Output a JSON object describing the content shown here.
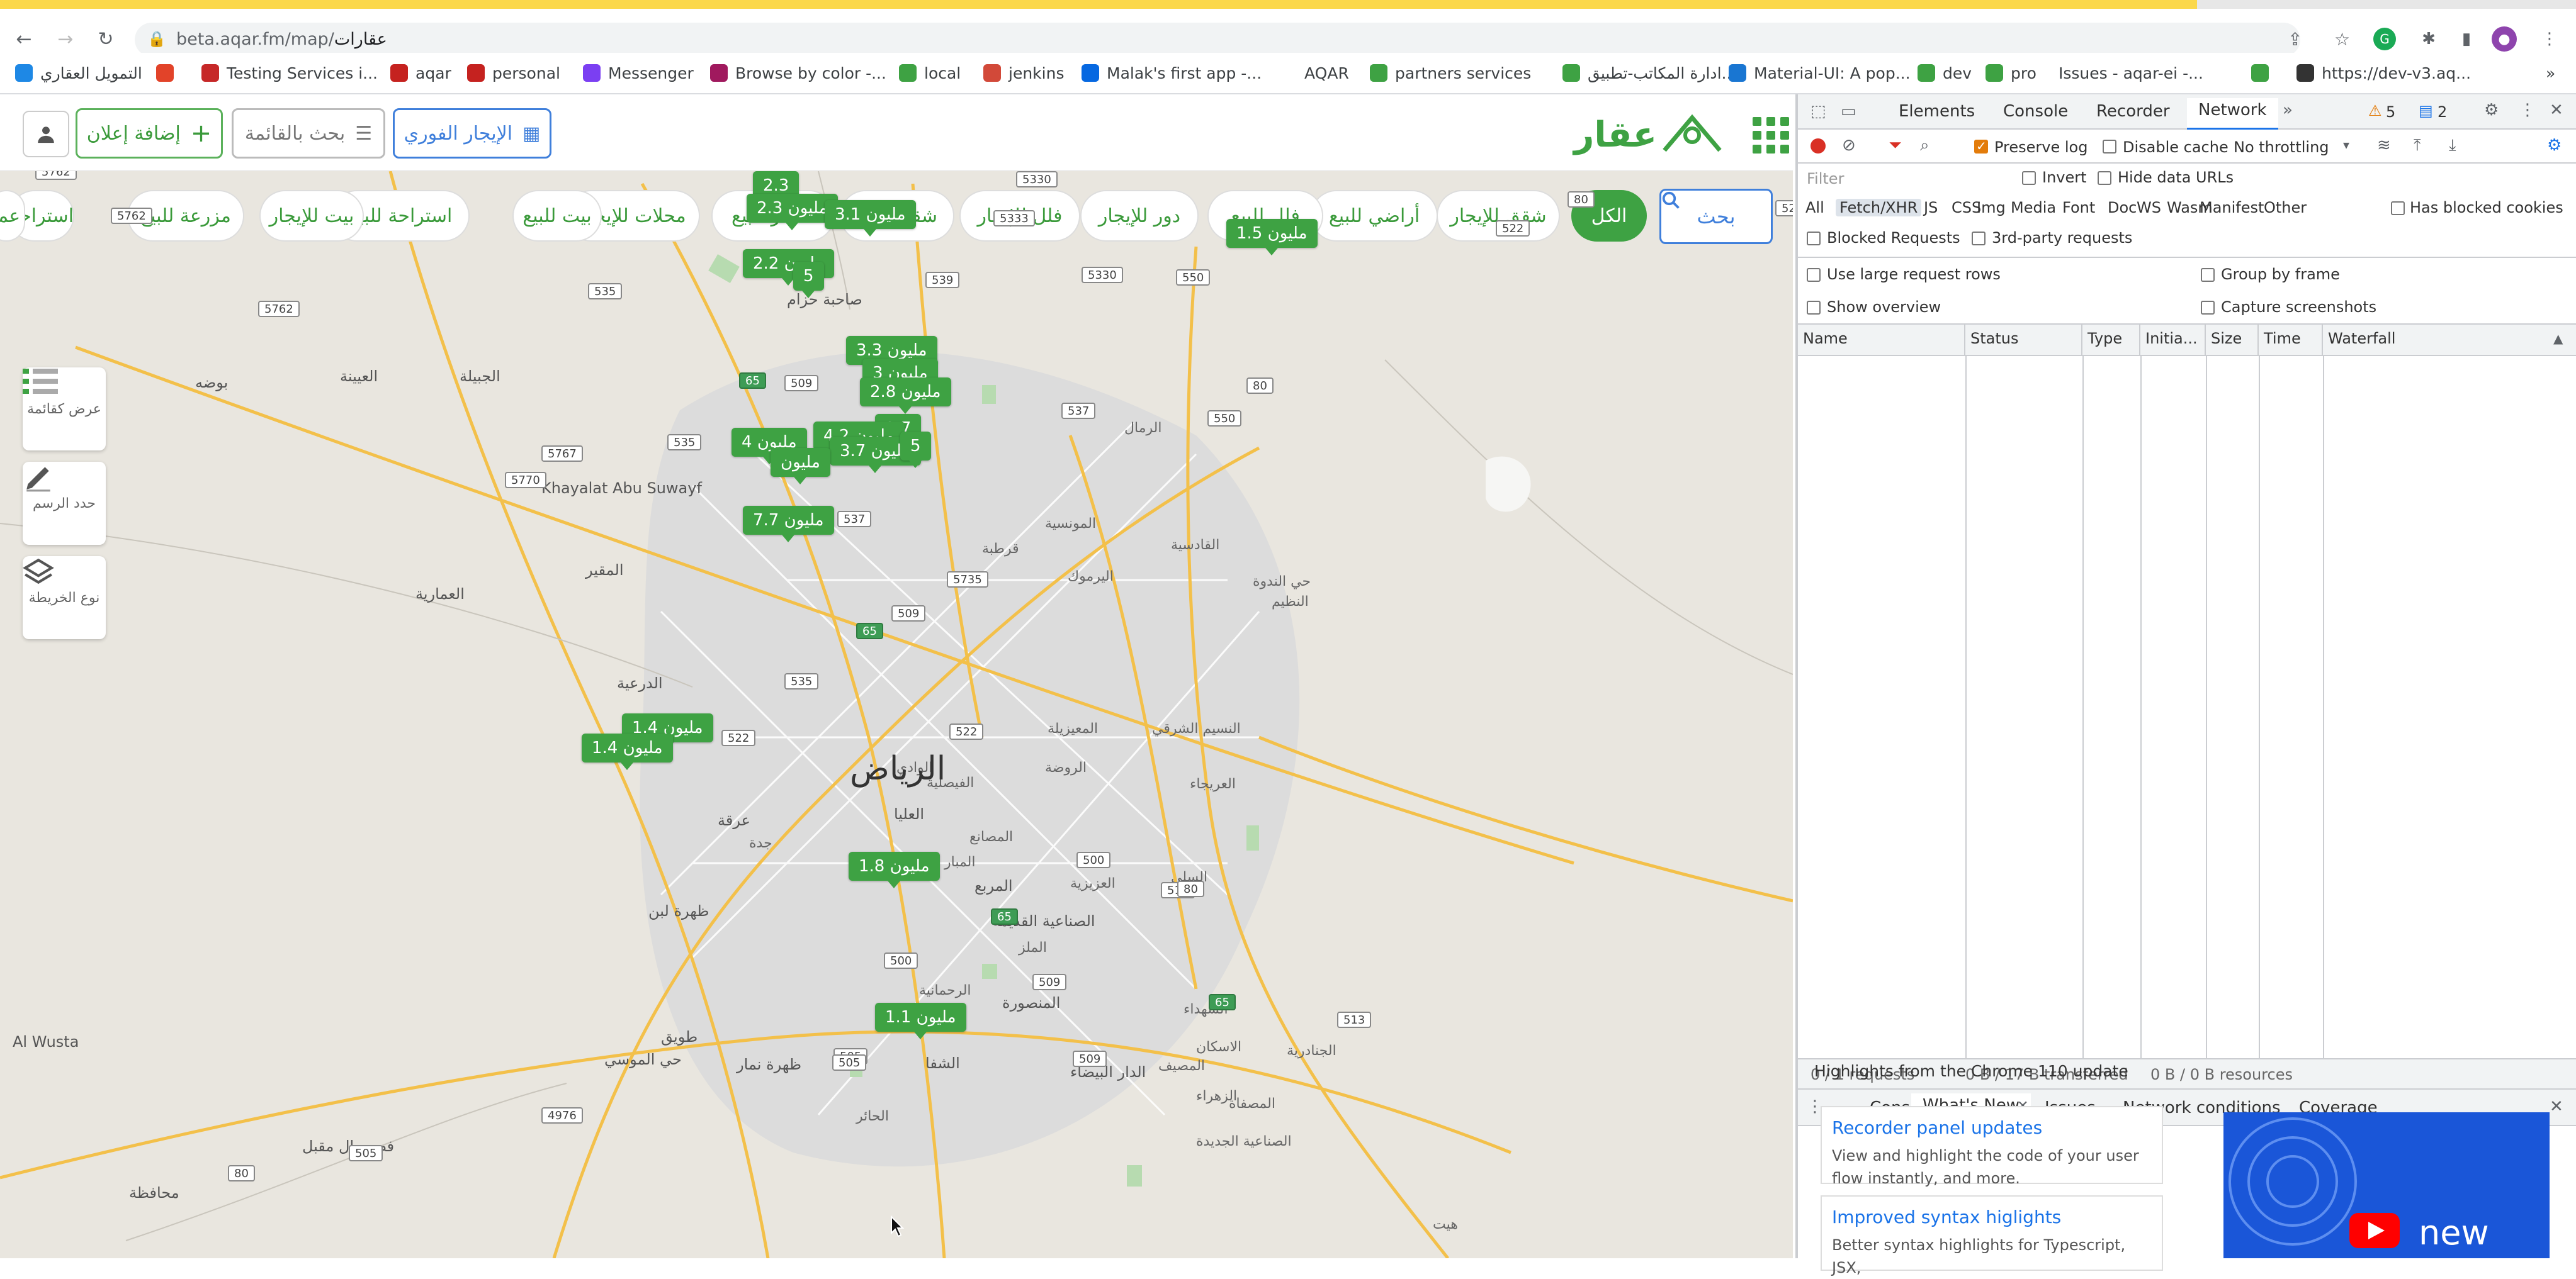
{
  "browser": {
    "url_host": "beta.aqar.fm/map/",
    "url_path": "عقارات",
    "bookmarks": [
      {
        "label": "التمويل العقاري",
        "icon": "globe-icon",
        "color": "#1e88e5"
      },
      {
        "label": "",
        "icon": "gitlab-icon",
        "color": "#e24329"
      },
      {
        "label": "Testing Services i...",
        "icon": "service-icon",
        "color": "#c62828"
      },
      {
        "label": "aqar",
        "icon": "gmail-icon",
        "color": "#c5221f"
      },
      {
        "label": "personal",
        "icon": "gmail-icon",
        "color": "#c5221f"
      },
      {
        "label": "Messenger",
        "icon": "messenger-icon",
        "color": "#7b3ff2"
      },
      {
        "label": "Browse by color -...",
        "icon": "color-icon",
        "color": "#a0195e"
      },
      {
        "label": "local",
        "icon": "leaf-icon",
        "color": "#3ea243"
      },
      {
        "label": "jenkins",
        "icon": "jenkins-icon",
        "color": "#d24939"
      },
      {
        "label": "Malak's first app -...",
        "icon": "meta-icon",
        "color": "#0668e1"
      },
      {
        "label": "AQAR",
        "icon": "",
        "color": ""
      },
      {
        "label": "partners services",
        "icon": "leaf-icon",
        "color": "#3ea243"
      },
      {
        "label": "ادارة المكاتب-تطبيق...",
        "icon": "leaf-icon",
        "color": "#3ea243"
      },
      {
        "label": "Material-UI: A pop...",
        "icon": "mui-icon",
        "color": "#1976d2"
      },
      {
        "label": "dev",
        "icon": "leaf-icon",
        "color": "#3ea243"
      },
      {
        "label": "pro",
        "icon": "leaf-icon",
        "color": "#3ea243"
      },
      {
        "label": "Issues - aqar-ei -...",
        "icon": "",
        "color": ""
      },
      {
        "label": "",
        "icon": "leaf-icon",
        "color": "#3ea243"
      },
      {
        "label": "https://dev-v3.aq...",
        "icon": "globe-icon",
        "color": "#333"
      }
    ]
  },
  "header": {
    "logo_text": "عقار",
    "instant_rent": "الإيجار الفوري",
    "list_search": "بحث بالقائمة",
    "add_listing": "إضافة إعلان"
  },
  "categories": {
    "search": "بحث",
    "items": [
      "الكل",
      "شقق للإيجار",
      "أراضي للبيع",
      "فلل للبيع",
      "دور للإيجار",
      "فلل للإيجار",
      "شقق للبيع",
      "عمائر للبيع",
      "محلات للإيجار",
      "بيت للبيع",
      "استراحة للبيع",
      "بيت للإيجار",
      "مزرعة للبيع",
      "استراحة",
      "عما"
    ]
  },
  "tools": [
    {
      "label": "عرض كقائمة",
      "icon": "list-icon"
    },
    {
      "label": "حدد الرسم",
      "icon": "pencil-icon"
    },
    {
      "label": "نوع الخريطة",
      "icon": "layers-icon"
    }
  ],
  "map": {
    "city": "الرياض",
    "pins": [
      "2.3",
      "2.3 مليون",
      "3.1 مليون",
      "2.2 مليون",
      "5",
      "1.5 مليون",
      "3.3 مليون",
      "3 مليون",
      "2.8 مليون",
      "2.7",
      "4.2 مليون",
      "4 مليون",
      "3.7 مليون",
      "5",
      "مليون",
      "7.7 مليون",
      "1.4 مليون",
      "1.4 مليون",
      "1.8 مليون",
      "1.1 مليون"
    ],
    "places": [
      "صاحبة حزام",
      "بوضه",
      "العيينة",
      "الجبيلة",
      "Khayalat Abu Suwayf",
      "المقير",
      "العمارية",
      "الدرعية",
      "عرقة",
      "طويق",
      "ظهرة نمار",
      "فصور ال مقبل",
      "محافظة",
      "Al Wusta",
      "ظهرة لبن",
      "حي الموسي",
      "الشفا",
      "الدار البيضاء",
      "المنصورة",
      "الصناعية القديمة",
      "المربع",
      "العليا",
      "حي الندوة",
      "النظيم",
      "المونسية",
      "قرطبة",
      "الرمال",
      "الوادي",
      "المعيزيلة",
      "النسيم الشرقي",
      "السلي",
      "الملز",
      "الروضة",
      "الفيصلية",
      "الشهداء",
      "المصيف",
      "الرحمانية",
      "الزهراء",
      "جدة",
      "المصانع",
      "المبار",
      "العزيزية",
      "العريجاء",
      "القادسية",
      "اليرموك",
      "الاسكان",
      "الجنادرية",
      "المصفاة",
      "الصناعية الجديدة",
      "هيت",
      "الحائر"
    ],
    "shields": [
      "5762",
      "5762",
      "5762",
      "535",
      "5770",
      "5767",
      "535",
      "5330",
      "5333",
      "539",
      "5330",
      "550",
      "80",
      "522",
      "522",
      "537",
      "550",
      "80",
      "65",
      "509",
      "537",
      "5735",
      "509",
      "65",
      "535",
      "80",
      "522",
      "522",
      "500",
      "513",
      "65",
      "500",
      "509",
      "505",
      "505",
      "509",
      "513",
      "65",
      "4976",
      "505",
      "80",
      "80"
    ]
  },
  "devtools": {
    "tabs": [
      "Elements",
      "Console",
      "Recorder",
      "Network"
    ],
    "warnings": "5",
    "messages": "2",
    "toolbar": {
      "preserve_log": "Preserve log",
      "disable_cache": "Disable cache",
      "throttling": "No throttling"
    },
    "filter": {
      "placeholder": "Filter",
      "invert": "Invert",
      "hide_data_urls": "Hide data URLs"
    },
    "types": [
      "All",
      "Fetch/XHR",
      "JS",
      "CSS",
      "Img",
      "Media",
      "Font",
      "Doc",
      "WS",
      "Wasm",
      "Manifest",
      "Other"
    ],
    "has_blocked_cookies": "Has blocked cookies",
    "blocked_requests": "Blocked Requests",
    "third_party": "3rd-party requests",
    "large_rows": "Use large request rows",
    "group_by_frame": "Group by frame",
    "show_overview": "Show overview",
    "capture_screenshots": "Capture screenshots",
    "columns": [
      "Name",
      "Status",
      "Type",
      "Initia...",
      "Size",
      "Time",
      "Waterfall"
    ],
    "status": {
      "requests": "0 / 1 requests",
      "transferred": "0 B / 17 B transferred",
      "resources": "0 B / 0 B resources"
    },
    "drawer_tabs": [
      "Console",
      "What's New",
      "Issues",
      "Network conditions",
      "Coverage"
    ],
    "highlights": "Highlights from the Chrome 110 update",
    "cards": [
      {
        "title": "Recorder panel updates",
        "desc": "View and highlight the code of your user flow instantly, and more."
      },
      {
        "title": "Improved syntax higlights",
        "desc": "Better syntax highlights for Typescript, JSX,"
      }
    ],
    "promo_text": "new"
  }
}
